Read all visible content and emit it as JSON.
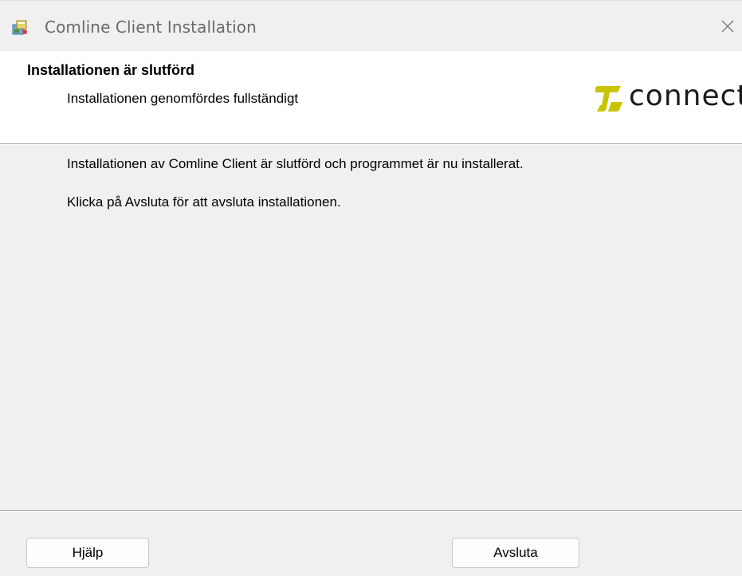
{
  "window": {
    "title": "Comline Client Installation"
  },
  "banner": {
    "heading": "Installationen är slutförd",
    "subheading": "Installationen genomfördes fullständigt",
    "logo_text": "connect"
  },
  "content": {
    "line1": "Installationen av Comline Client är slutförd och programmet är nu installerat.",
    "line2": "Klicka på Avsluta för att avsluta installationen."
  },
  "buttons": {
    "help_label": "Hjälp",
    "finish_label": "Avsluta"
  },
  "colors": {
    "logo_accent": "#c8c400",
    "logo_text": "#1a1a1a",
    "dialog_background": "#f0f0f0",
    "banner_background": "#ffffff"
  },
  "icons": {
    "app": "installer-package-icon",
    "close": "close-icon"
  }
}
